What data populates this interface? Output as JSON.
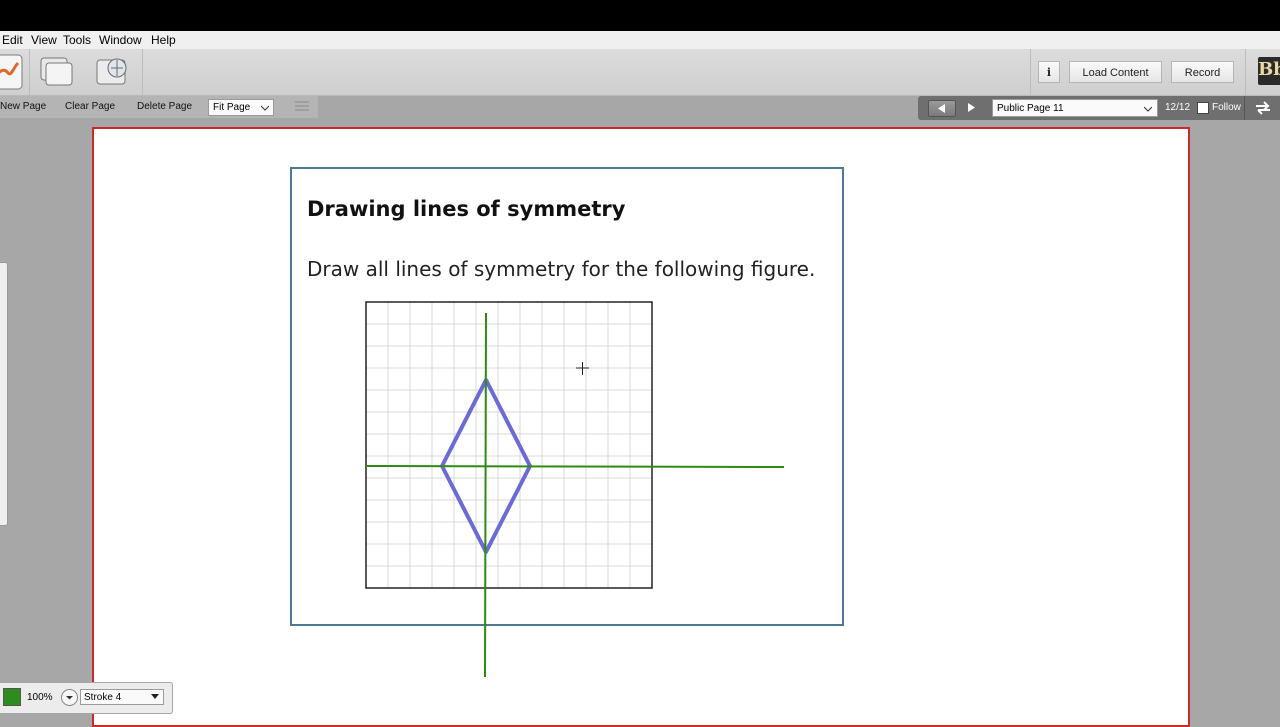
{
  "menu": [
    "Edit",
    "View",
    "Tools",
    "Window",
    "Help"
  ],
  "toolbar": {
    "load_content": "Load Content",
    "record": "Record",
    "info": "i"
  },
  "subbar": {
    "new_page": "New Page",
    "clear_page": "Clear Page",
    "delete_page": "Delete Page",
    "fit_page": "Fit Page"
  },
  "nav": {
    "page_select": "Public Page 11",
    "page_count": "12/12",
    "follow": "Follow"
  },
  "content": {
    "title": "Drawing lines of symmetry",
    "question": "Draw all lines of symmetry for the following figure."
  },
  "bottom": {
    "zoom": "100%",
    "stroke": "Stroke 4"
  },
  "colors": {
    "frame": "#cc2a2a",
    "card_border": "#4f7894",
    "diamond": "#6b6bd6",
    "symmetry_line": "#2f8a14",
    "ink_swatch": "#2e8b1e"
  },
  "icons": [
    "pen-tool-icon",
    "whiteboard-icon",
    "web-tour-icon",
    "info-icon",
    "prev-page-icon",
    "next-page-icon",
    "sync-icon",
    "dropdown-arrow-icon"
  ]
}
